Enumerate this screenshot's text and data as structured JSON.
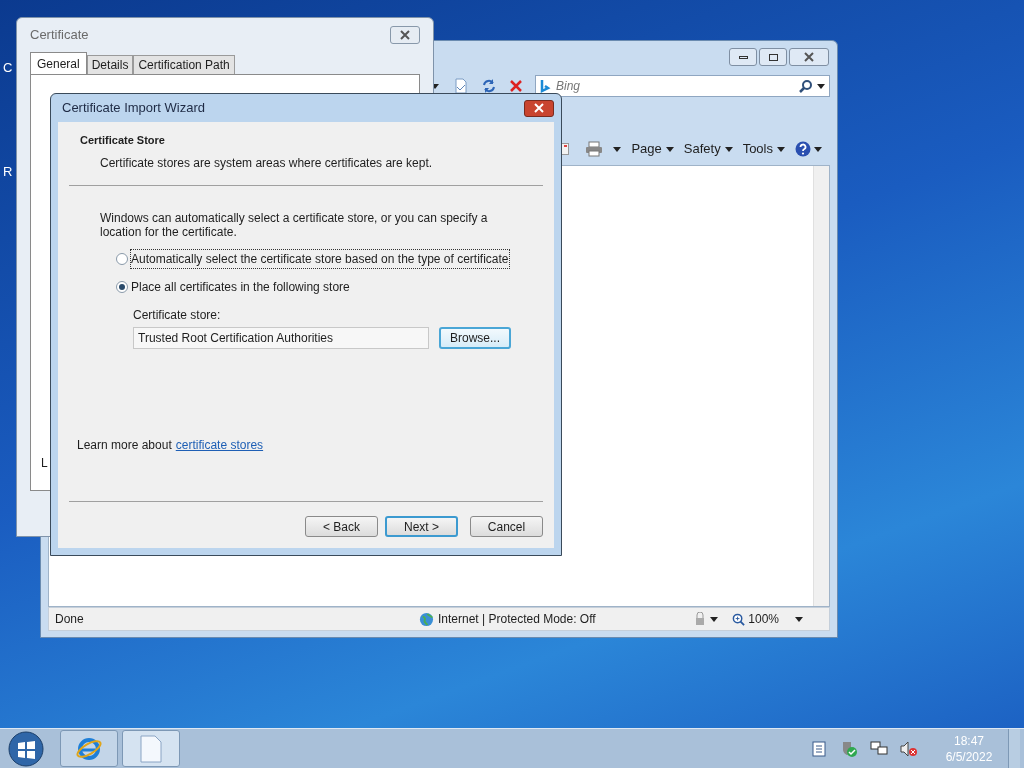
{
  "desktop": {
    "icon_labels": [
      "C",
      "R"
    ]
  },
  "browser": {
    "search": {
      "placeholder": "Bing"
    },
    "commands": [
      {
        "label": "Page"
      },
      {
        "label": "Safety"
      },
      {
        "label": "Tools"
      }
    ],
    "status_bar": {
      "text": "Done",
      "zone": "Internet | Protected Mode: Off",
      "zoom": "100%"
    }
  },
  "certificate_window": {
    "title": "Certificate",
    "tabs": [
      {
        "label": "General",
        "selected": true
      },
      {
        "label": "Details",
        "selected": false
      },
      {
        "label": "Certification Path",
        "selected": false
      }
    ],
    "panel_text": "L"
  },
  "wizard": {
    "title": "Certificate Import Wizard",
    "heading": "Certificate Store",
    "subheading": "Certificate stores are system areas where certificates are kept.",
    "intro": "Windows can automatically select a certificate store, or you can specify a location for the certificate.",
    "options": [
      {
        "label": "Automatically select the certificate store based on the type of certificate",
        "selected": false
      },
      {
        "label": "Place all certificates in the following store",
        "selected": true
      }
    ],
    "store_label": "Certificate store:",
    "store_value": "Trusted Root Certification Authorities",
    "browse": "Browse...",
    "learn_more": {
      "text": "Learn more about",
      "link": "certificate stores"
    },
    "buttons": [
      {
        "label": "< Back",
        "default": false
      },
      {
        "label": "Next >",
        "default": true
      },
      {
        "label": "Cancel",
        "default": false
      }
    ]
  },
  "taskbar": {
    "time": "18:47",
    "date": "6/5/2022"
  }
}
